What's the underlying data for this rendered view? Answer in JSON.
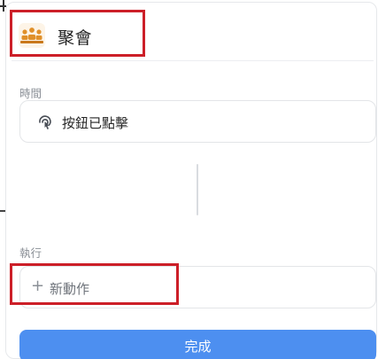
{
  "header": {
    "title": "聚會",
    "icon": "group-meeting-icon"
  },
  "sections": {
    "time_label": "時間",
    "run_label": "執行"
  },
  "trigger": {
    "label": "按鈕已點擊",
    "icon": "tap-gesture-icon"
  },
  "action": {
    "add_symbol": "+",
    "label": "新動作"
  },
  "footer": {
    "done_label": "完成"
  },
  "colors": {
    "accent": "#4d8ff0",
    "highlight": "#cc1f28",
    "icon_orange": "#e0902a"
  }
}
